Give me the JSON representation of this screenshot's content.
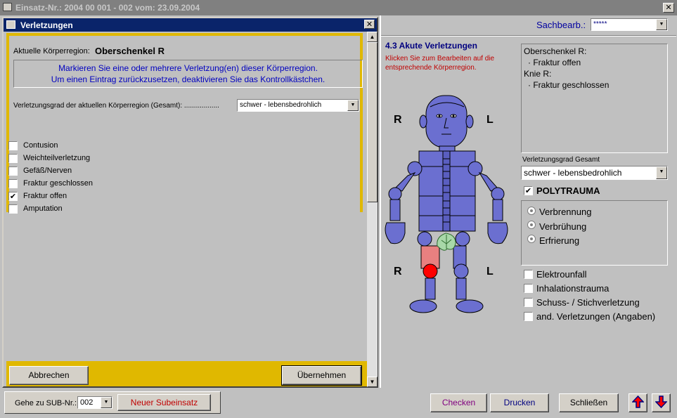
{
  "window": {
    "title": "Einsatz-Nr.:  2004 00 001 - 002    vom: 23.09.2004"
  },
  "dialog": {
    "title": "Verletzungen",
    "region_label": "Aktuelle Körperregion:",
    "region_value": "Oberschenkel R",
    "info_line1": "Markieren Sie eine oder mehrere Verletzung(en) dieser Körperregion.",
    "info_line2": "Um einen Eintrag zurückzusetzen, deaktivieren Sie das Kontrollkästchen.",
    "grade_label": "Verletzungsgrad der aktuellen Körperregion (Gesamt):  ..................",
    "grade_value": "schwer - lebensbedrohlich",
    "injuries": [
      {
        "label": "Contusion",
        "checked": false
      },
      {
        "label": "Weichteilverletzung",
        "checked": false
      },
      {
        "label": "Gefäß/Nerven",
        "checked": false
      },
      {
        "label": "Fraktur geschlossen",
        "checked": false
      },
      {
        "label": "Fraktur offen",
        "checked": true
      },
      {
        "label": "Amputation",
        "checked": false
      }
    ],
    "cancel_label": "Abbrechen",
    "apply_label": "Übernehmen"
  },
  "right": {
    "sachbearb_label": "Sachbearb.:",
    "sachbearb_value": "*****",
    "section_title": "4.3 Akute Verletzungen",
    "hint_line1": "Klicken Sie zum Bearbeiten auf die",
    "hint_line2": "entsprechende Körperregion.",
    "side_r": "R",
    "side_l": "L",
    "summary_lines": [
      "Oberschenkel R:",
      "  · Fraktur offen",
      "Knie R:",
      "  · Fraktur geschlossen"
    ],
    "grade_total_label": "Verletzungsgrad Gesamt",
    "grade_total_value": "schwer - lebensbedrohlich",
    "polytrauma_label": "POLYTRAUMA",
    "radios": [
      "Verbrennung",
      "Verbrühung",
      "Erfrierung"
    ],
    "extras": [
      "Elektrounfall",
      "Inhalationstrauma",
      "Schuss- / Stichverletzung",
      "and. Verletzungen (Angaben)"
    ],
    "colors": {
      "body": "#6b6fd0",
      "injury_open": "#e88080",
      "injury_closed": "#ff0000",
      "accent": "#e0b800"
    }
  },
  "bottom": {
    "sub_label": "Gehe zu SUB-Nr.:",
    "sub_value": "002",
    "new_sub": "Neuer Subeinsatz",
    "check": "Checken",
    "print": "Drucken",
    "close": "Schließen"
  }
}
